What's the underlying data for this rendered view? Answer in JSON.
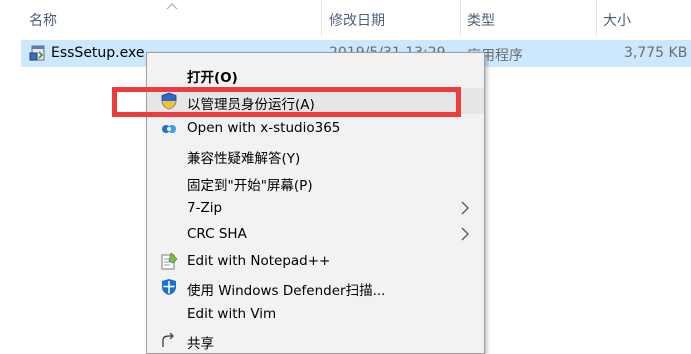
{
  "header": {
    "columns": [
      {
        "label": "名称"
      },
      {
        "label": "修改日期"
      },
      {
        "label": "类型"
      },
      {
        "label": "大小"
      }
    ]
  },
  "file": {
    "name": "EssSetup.exe",
    "modified": "2019/5/31 13:29",
    "type": "应用程序",
    "size": "3,775 KB"
  },
  "context_menu": {
    "items": [
      {
        "label": "打开(O)",
        "icon": "none",
        "bold": true
      },
      {
        "label": "以管理员身份运行(A)",
        "icon": "uac-shield-icon",
        "highlighted": true
      },
      {
        "label": "Open with x-studio365",
        "icon": "x-studio365-icon"
      },
      {
        "label": "兼容性疑难解答(Y)",
        "icon": "none"
      },
      {
        "label": "固定到\"开始\"屏幕(P)",
        "icon": "none"
      },
      {
        "label": "7-Zip",
        "icon": "none",
        "submenu": true
      },
      {
        "label": "CRC SHA",
        "icon": "none",
        "submenu": true
      },
      {
        "label": "Edit with Notepad++",
        "icon": "notepadpp-icon"
      },
      {
        "label": "使用 Windows Defender扫描...",
        "icon": "windows-defender-icon"
      },
      {
        "label": "Edit with Vim",
        "icon": "none"
      },
      {
        "label": "共享",
        "icon": "share-icon"
      }
    ]
  },
  "colors": {
    "selection": "#cce8ff",
    "menu_background": "#f2f2f2",
    "highlight_border": "#ee3b3b",
    "header_text": "#4c607a"
  }
}
